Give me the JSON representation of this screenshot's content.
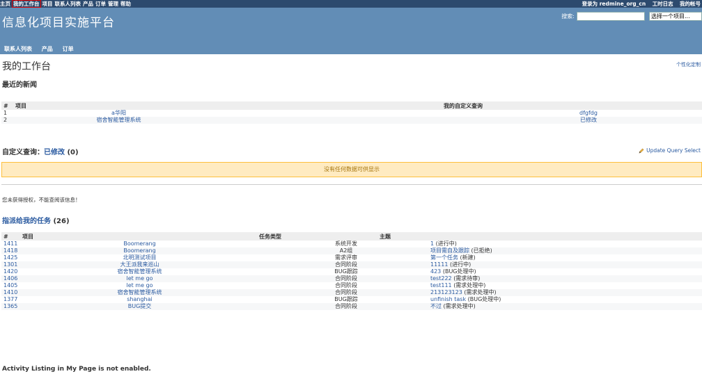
{
  "top_menu": {
    "items": [
      "主页",
      "我的工作台",
      "项目",
      "联系人列表",
      "产品",
      "订单",
      "管理",
      "帮助"
    ],
    "active_index": 1,
    "logged_in_as": "登录为 redmine_org_cn",
    "links": [
      "工时日志",
      "我的帐号"
    ]
  },
  "header": {
    "title": "信息化项目实施平台",
    "search_label": "搜索:",
    "project_select": "选择一个项目..."
  },
  "main_menu": [
    "联系人列表",
    "产品",
    "订单"
  ],
  "page": {
    "title": "我的工作台",
    "personalize": "个性化定制"
  },
  "news": {
    "heading": "最近的新闻",
    "columns": [
      "#",
      "项目",
      "我的自定义查询"
    ],
    "rows": [
      {
        "id": "1",
        "project": "a华阳",
        "query": "dfgfdg"
      },
      {
        "id": "2",
        "project": "宿舍智能管理系统",
        "query": "已修改"
      }
    ]
  },
  "custom_query": {
    "label": "自定义查询：",
    "name": "已修改",
    "count": "(0)",
    "update_link": "Update Query Select",
    "no_data": "没有任何数据可供显示"
  },
  "auth_note": "您未获得授权，不能查阅该信息！",
  "assigned": {
    "heading": "指派给我的任务",
    "count": "(26)",
    "columns": [
      "#",
      "项目",
      "任务类型",
      "主题"
    ],
    "rows": [
      {
        "id": "1411",
        "project": "Boomerang",
        "type": "系统开发",
        "subject": "1",
        "status": "(进行中)"
      },
      {
        "id": "1418",
        "project": "Boomerang",
        "type": "A2组",
        "subject": "项目需自及跟踪",
        "status": "(已拒绝)"
      },
      {
        "id": "1425",
        "project": "北明测试项目",
        "type": "需求评审",
        "subject": "第一个任务",
        "status": "(新建)"
      },
      {
        "id": "1301",
        "project": "大王派我来巡山",
        "type": "合同阶段",
        "subject": "11111",
        "status": "(进行中)"
      },
      {
        "id": "1420",
        "project": "宿舍智能管理系统",
        "type": "BUG跟踪",
        "subject": "423",
        "status": "(BUG处理中)"
      },
      {
        "id": "1406",
        "project": "let me go",
        "type": "合同阶段",
        "subject": "test222",
        "status": "(需求待审)"
      },
      {
        "id": "1405",
        "project": "let me go",
        "type": "合同阶段",
        "subject": "test111",
        "status": "(需求处理中)"
      },
      {
        "id": "1410",
        "project": "宿舍智能管理系统",
        "type": "合同阶段",
        "subject": "213123123",
        "status": "(需求处理中)"
      },
      {
        "id": "1377",
        "project": "shanghai",
        "type": "BUG跟踪",
        "subject": "unfinish task",
        "status": "(BUG处理中)"
      },
      {
        "id": "1365",
        "project": "BUG提交",
        "type": "合同阶段",
        "subject": "不过",
        "status": "(需求处理中)"
      }
    ]
  },
  "footer_note": "Activity Listing in My Page is not enabled.",
  "colors": {
    "top_bar": "#2c4a6e",
    "header": "#628db6",
    "link": "#2a5aa0",
    "warning_bg": "#ffebc1"
  }
}
